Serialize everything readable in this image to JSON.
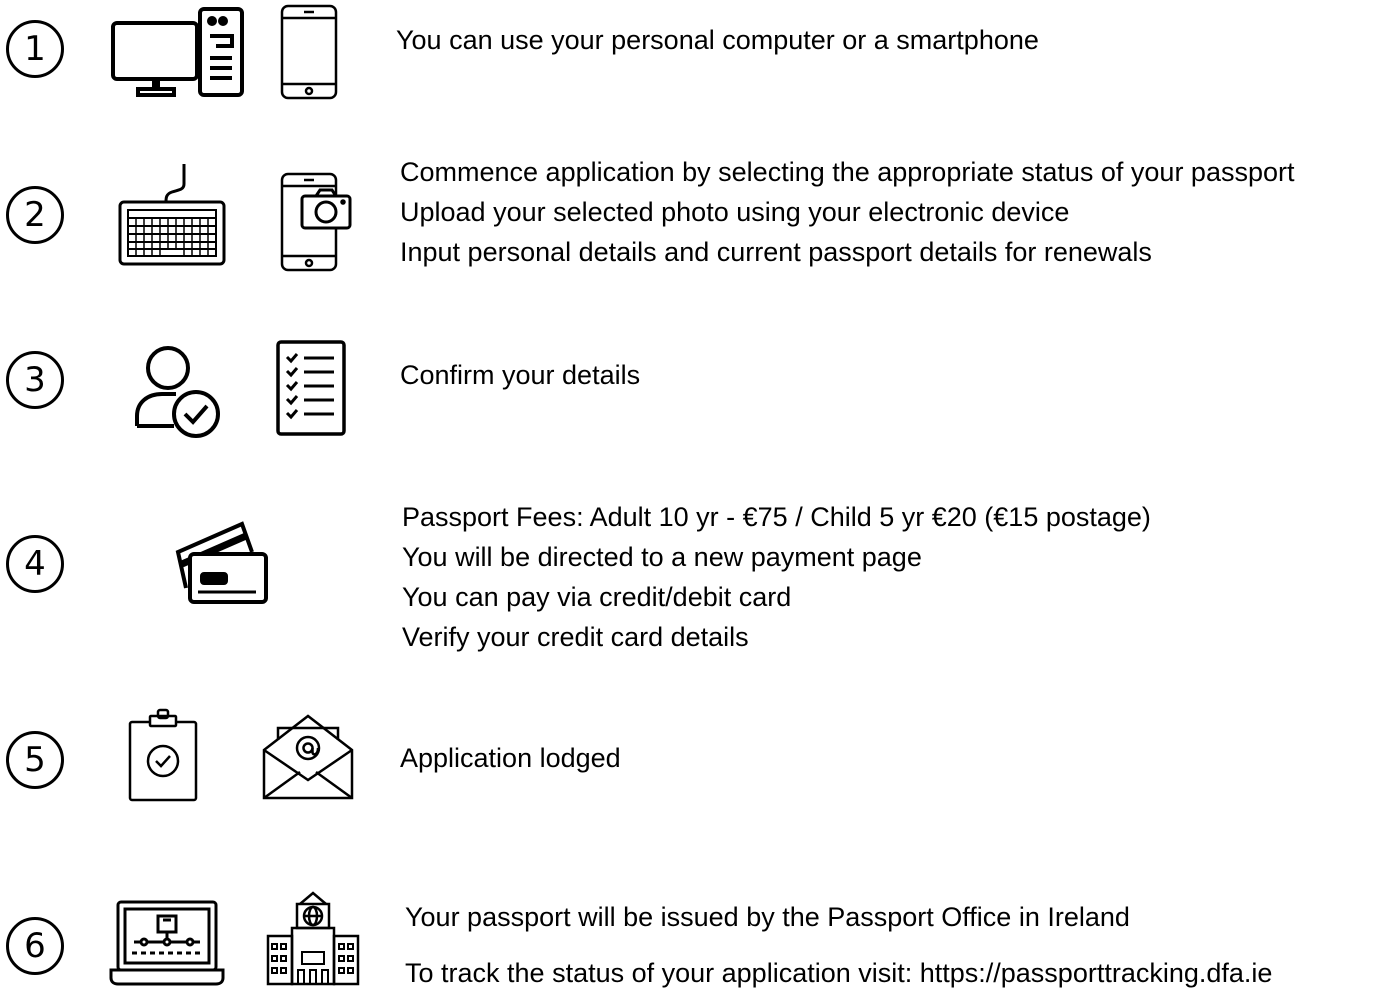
{
  "steps": [
    {
      "number": "1",
      "icons": [
        "desktop-computer-icon",
        "smartphone-icon"
      ],
      "lines": [
        "You can use your personal computer or a smartphone"
      ]
    },
    {
      "number": "2",
      "icons": [
        "keyboard-icon",
        "smartphone-camera-icon"
      ],
      "lines": [
        "Commence application by selecting the appropriate status of your passport",
        "Upload your selected photo using  your electronic device",
        "Input personal details and current passport details for renewals"
      ]
    },
    {
      "number": "3",
      "icons": [
        "user-check-icon",
        "checklist-icon"
      ],
      "lines": [
        "Confirm your details"
      ]
    },
    {
      "number": "4",
      "icons": [
        "credit-cards-icon"
      ],
      "lines": [
        "Passport Fees: Adult 10 yr - €75 / Child 5 yr €20 (€15 postage)",
        "You will be directed to a new payment page",
        "You can pay via credit/debit card",
        "Verify your credit card details"
      ]
    },
    {
      "number": "5",
      "icons": [
        "clipboard-check-icon",
        "email-envelope-icon"
      ],
      "lines": [
        "Application lodged"
      ]
    },
    {
      "number": "6",
      "icons": [
        "laptop-icon",
        "government-building-icon"
      ],
      "lines": [
        "Your passport will be issued by the Passport Office in Ireland",
        "To track the status of your application visit: https://passporttracking.dfa.ie"
      ]
    }
  ]
}
